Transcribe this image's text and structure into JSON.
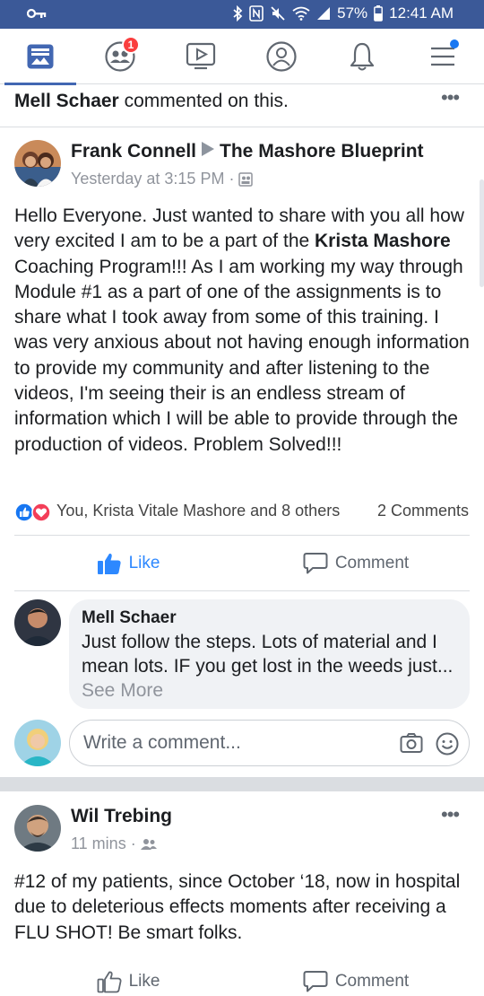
{
  "status_bar": {
    "battery": "57%",
    "time": "12:41 AM"
  },
  "nav": {
    "items": [
      {
        "name": "news-feed"
      },
      {
        "name": "friend-requests",
        "badge": "1"
      },
      {
        "name": "watch"
      },
      {
        "name": "profile"
      },
      {
        "name": "notifications"
      },
      {
        "name": "menu"
      }
    ],
    "accent": "#4267b2"
  },
  "story_header": {
    "actor": "Mell Schaer",
    "action": "commented on this."
  },
  "post": {
    "author": "Frank Connell",
    "group": "The Mashore Blueprint",
    "time": "Yesterday at 3:15 PM",
    "privacy_separator": "·",
    "body": {
      "p1": "Hello Everyone. Just wanted to share with you all how very excited I am to be a part of the ",
      "bold": "Krista Mashore",
      "p2": " Coaching Program!!!  As I am working my way through Module #1 as a part of one of the assignments is to share what I took away from some of this training. I was very anxious about not having enough information to provide my community and after listening to the videos, I'm seeing their is an endless stream of information which I will be able to provide through the production of videos. Problem Solved!!!"
    },
    "reactions_text": "You, Krista Vitale Mashore and 8 others",
    "comments_count": "2 Comments",
    "like_label": "Like",
    "comment_label": "Comment",
    "like_color": "#2d88ff"
  },
  "comment": {
    "author": "Mell Schaer",
    "text": "Just follow the steps. Lots of material and I mean lots. IF you get lost in the weeds just... ",
    "see_more": "See More"
  },
  "composer": {
    "placeholder": "Write a comment..."
  },
  "post2": {
    "author": "Wil Trebing",
    "time": "11 mins",
    "privacy_separator": "·",
    "body": "#12 of my patients, since October ‘18, now in hospital due to deleterious effects moments after receiving a FLU SHOT!  Be smart folks.",
    "like_label": "Like",
    "comment_label": "Comment"
  }
}
